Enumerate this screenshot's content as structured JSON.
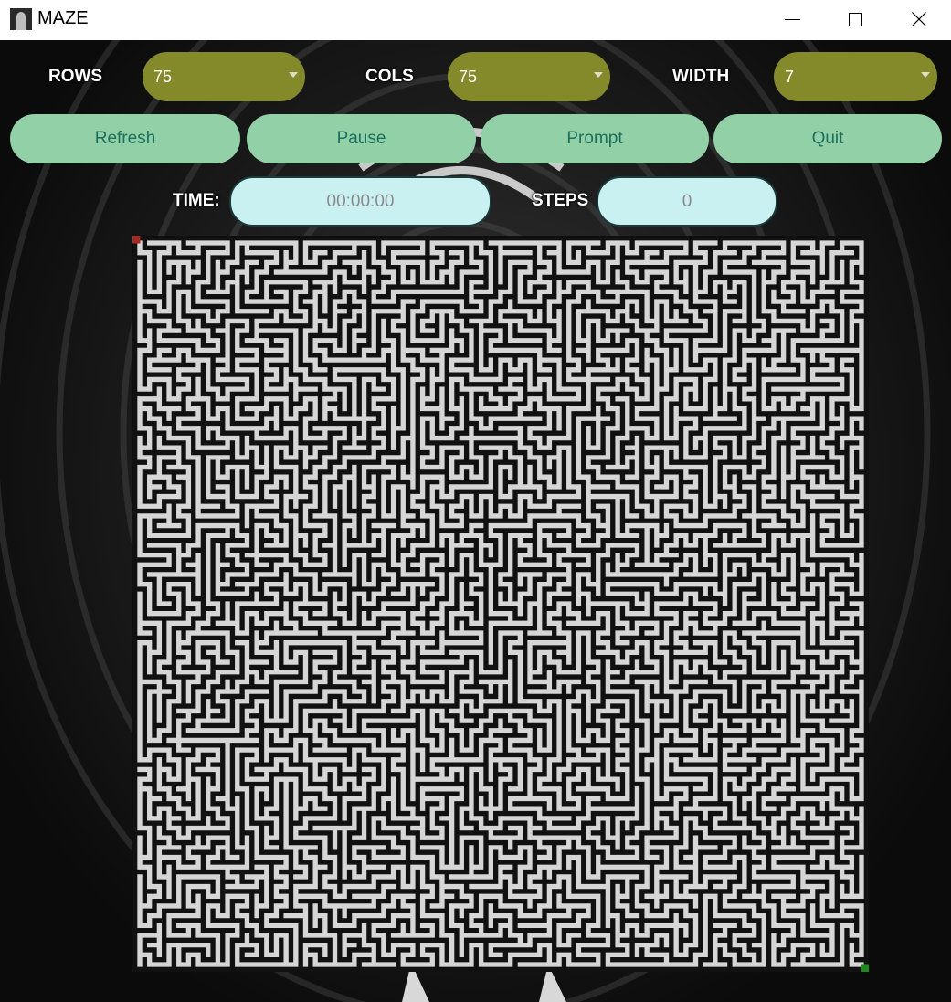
{
  "window": {
    "title": "MAZE"
  },
  "controls": {
    "rows": {
      "label": "ROWS",
      "value": "75"
    },
    "cols": {
      "label": "COLS",
      "value": "75"
    },
    "width": {
      "label": "WIDTH",
      "value": "7"
    }
  },
  "buttons": {
    "refresh": "Refresh",
    "pause": "Pause",
    "prompt": "Prompt",
    "quit": "Quit"
  },
  "status": {
    "time_label": "TIME:",
    "time_value": "00:00:00",
    "steps_label": "STEPS",
    "steps_value": "0"
  },
  "maze": {
    "rows": 75,
    "cols": 75,
    "wall_color": "#111111",
    "path_color": "#d6d6d6",
    "start_color": "#a32a22",
    "end_color": "#1f8a1f"
  },
  "icons": {
    "app": "app-photo-icon",
    "minimize": "minimize-icon",
    "maximize": "maximize-icon",
    "close": "close-icon"
  }
}
